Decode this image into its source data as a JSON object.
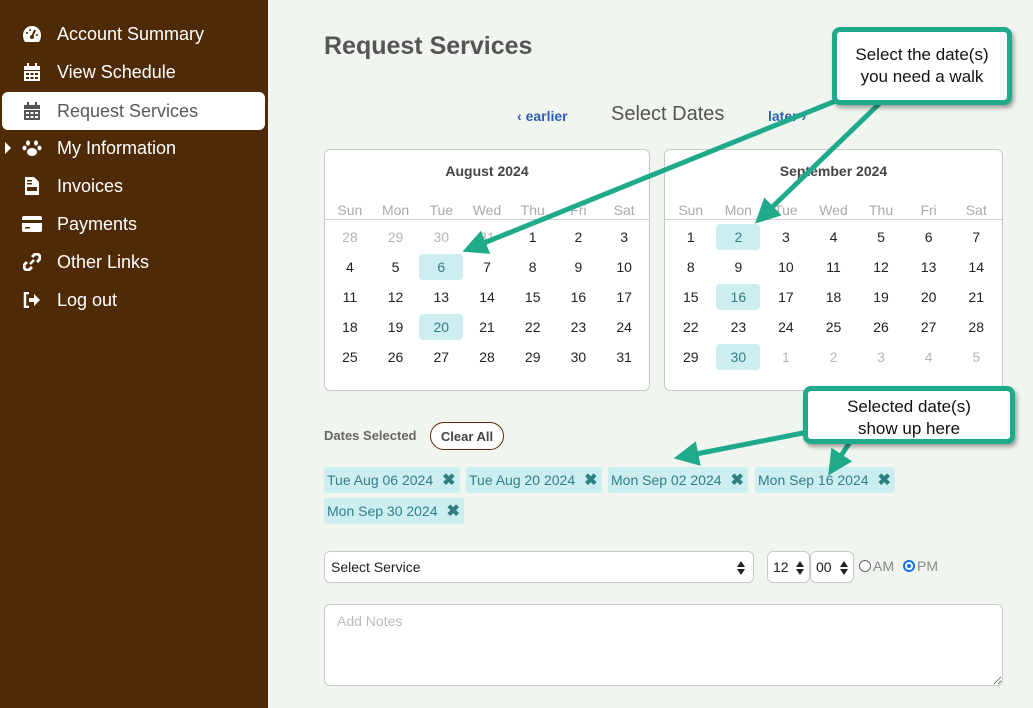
{
  "sidebar": {
    "items": [
      {
        "label": "Account Summary",
        "icon": "gauge-icon",
        "active": false
      },
      {
        "label": "View Schedule",
        "icon": "calendar-icon",
        "active": false
      },
      {
        "label": "Request Services",
        "icon": "calendar-icon",
        "active": true
      },
      {
        "label": "My Information",
        "icon": "paw-icon",
        "active": false,
        "expandable": true
      },
      {
        "label": "Invoices",
        "icon": "document-icon",
        "active": false
      },
      {
        "label": "Payments",
        "icon": "credit-card-icon",
        "active": false
      },
      {
        "label": "Other Links",
        "icon": "link-icon",
        "active": false
      },
      {
        "label": "Log out",
        "icon": "logout-icon",
        "active": false
      }
    ]
  },
  "main": {
    "title": "Request Services",
    "date_nav": {
      "earlier_label": "earlier",
      "heading": "Select Dates",
      "later_label": "later"
    },
    "calendars": [
      {
        "title": "August 2024",
        "weekdays": [
          "Sun",
          "Mon",
          "Tue",
          "Wed",
          "Thu",
          "Fri",
          "Sat"
        ],
        "days": [
          {
            "d": "28",
            "muted": true
          },
          {
            "d": "29",
            "muted": true
          },
          {
            "d": "30",
            "muted": true
          },
          {
            "d": "31",
            "muted": true
          },
          {
            "d": "1"
          },
          {
            "d": "2"
          },
          {
            "d": "3"
          },
          {
            "d": "4"
          },
          {
            "d": "5"
          },
          {
            "d": "6",
            "selected": true
          },
          {
            "d": "7"
          },
          {
            "d": "8"
          },
          {
            "d": "9"
          },
          {
            "d": "10"
          },
          {
            "d": "11"
          },
          {
            "d": "12"
          },
          {
            "d": "13"
          },
          {
            "d": "14"
          },
          {
            "d": "15"
          },
          {
            "d": "16"
          },
          {
            "d": "17"
          },
          {
            "d": "18"
          },
          {
            "d": "19"
          },
          {
            "d": "20",
            "selected": true
          },
          {
            "d": "21"
          },
          {
            "d": "22"
          },
          {
            "d": "23"
          },
          {
            "d": "24"
          },
          {
            "d": "25"
          },
          {
            "d": "26"
          },
          {
            "d": "27"
          },
          {
            "d": "28"
          },
          {
            "d": "29"
          },
          {
            "d": "30"
          },
          {
            "d": "31"
          }
        ]
      },
      {
        "title": "September 2024",
        "weekdays": [
          "Sun",
          "Mon",
          "Tue",
          "Wed",
          "Thu",
          "Fri",
          "Sat"
        ],
        "days": [
          {
            "d": "1"
          },
          {
            "d": "2",
            "selected": true
          },
          {
            "d": "3"
          },
          {
            "d": "4"
          },
          {
            "d": "5"
          },
          {
            "d": "6"
          },
          {
            "d": "7"
          },
          {
            "d": "8"
          },
          {
            "d": "9"
          },
          {
            "d": "10"
          },
          {
            "d": "11"
          },
          {
            "d": "12"
          },
          {
            "d": "13"
          },
          {
            "d": "14"
          },
          {
            "d": "15"
          },
          {
            "d": "16",
            "selected": true
          },
          {
            "d": "17"
          },
          {
            "d": "18"
          },
          {
            "d": "19"
          },
          {
            "d": "20"
          },
          {
            "d": "21"
          },
          {
            "d": "22"
          },
          {
            "d": "23"
          },
          {
            "d": "24"
          },
          {
            "d": "25"
          },
          {
            "d": "26"
          },
          {
            "d": "27"
          },
          {
            "d": "28"
          },
          {
            "d": "29"
          },
          {
            "d": "30",
            "selected": true
          },
          {
            "d": "1",
            "muted": true
          },
          {
            "d": "2",
            "muted": true
          },
          {
            "d": "3",
            "muted": true
          },
          {
            "d": "4",
            "muted": true
          },
          {
            "d": "5",
            "muted": true
          }
        ]
      }
    ],
    "dates_selected_label": "Dates Selected",
    "clear_all_label": "Clear All",
    "selected_dates": [
      "Tue Aug 06 2024",
      "Tue Aug 20 2024",
      "Mon Sep 02 2024",
      "Mon Sep 16 2024",
      "Mon Sep 30 2024"
    ],
    "remove_glyph": "✖",
    "service_select": {
      "value": "Select Service"
    },
    "time": {
      "hour": "12",
      "minute": "00",
      "am_label": "AM",
      "pm_label": "PM",
      "selected_period": "PM"
    },
    "notes": {
      "placeholder": "Add Notes",
      "value": ""
    }
  },
  "annotations": {
    "callout_1": [
      "Select the date(s)",
      "you need a walk"
    ],
    "callout_2": [
      "Selected date(s)",
      "show up here"
    ]
  },
  "colors": {
    "sidebar_bg": "#4f2a07",
    "page_bg": "#f1f5ef",
    "selected_bg": "#cdeef0",
    "selected_text": "#2f7f86",
    "link": "#2b5fb4",
    "callout_border": "#1faa8b",
    "radio_on": "#1a73e8"
  }
}
